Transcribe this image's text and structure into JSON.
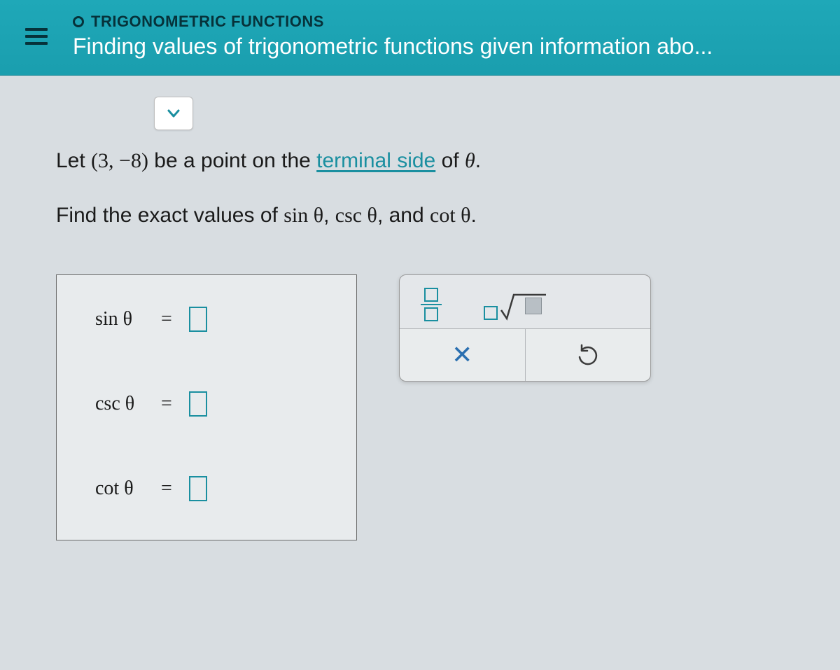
{
  "header": {
    "category": "TRIGONOMETRIC FUNCTIONS",
    "title": "Finding values of trigonometric functions given information abo..."
  },
  "problem": {
    "line1_prefix": "Let ",
    "point": "(3, −8)",
    "line1_mid": " be a point on the ",
    "link_text": "terminal side",
    "line1_suffix": " of ",
    "theta": "θ",
    "period": ".",
    "line2_prefix": "Find the exact values of ",
    "func1": "sin θ",
    "comma1": ", ",
    "func2": "csc θ",
    "comma2": ", and ",
    "func3": "cot θ"
  },
  "answers": {
    "rows": [
      {
        "label": "sin θ"
      },
      {
        "label": "csc θ"
      },
      {
        "label": "cot θ"
      }
    ],
    "equals": "="
  },
  "tools": {
    "clear_symbol": "✕"
  }
}
